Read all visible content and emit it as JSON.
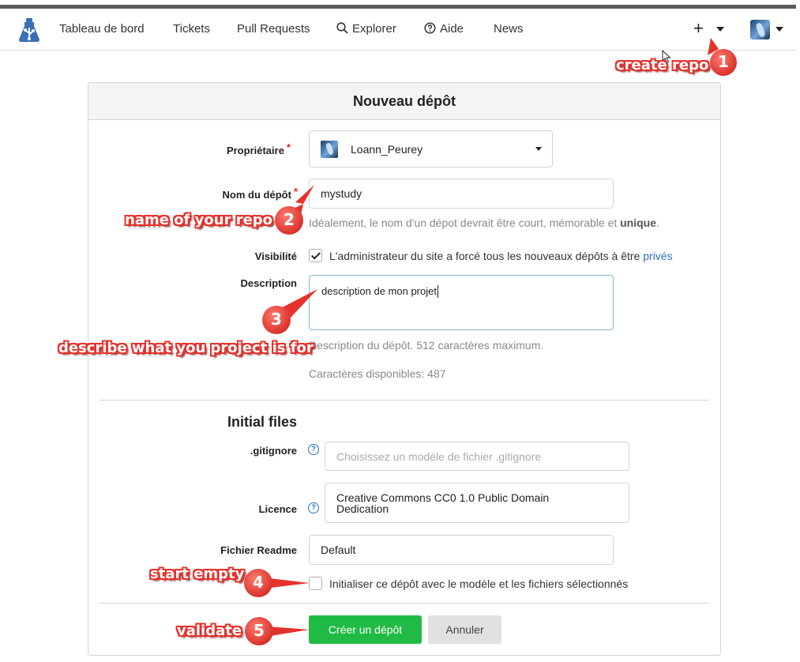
{
  "nav": {
    "items": [
      "Tableau de bord",
      "Tickets",
      "Pull Requests",
      "Explorer",
      "Aide",
      "News"
    ],
    "plus": "+"
  },
  "form": {
    "title": "Nouveau dépôt",
    "owner": {
      "label": "Propriétaire",
      "required": "*",
      "value": "Loann_Peurey"
    },
    "repo_name": {
      "label": "Nom du dépôt",
      "required": "*",
      "value": "mystudy",
      "hint_prefix": "Idéalement, le nom d'un dépot devrait être court, mémorable et ",
      "hint_bold": "unique",
      "hint_suffix": "."
    },
    "visibility": {
      "label": "Visibilité",
      "text": "L'administrateur du site a forcé tous les nouveaux dépôts à être ",
      "link": "privés",
      "checked": true
    },
    "description": {
      "label": "Description",
      "value": "description de mon projet",
      "hint": "Description du dépôt. 512 caractères maximum.",
      "available": "Caractères disponibles: 487"
    },
    "initial_files": {
      "title": "Initial files",
      "gitignore": {
        "label": ".gitignore",
        "placeholder": "Choisissez un modèle de fichier .gitignore"
      },
      "license": {
        "label": "Licence",
        "value": "Creative Commons CC0 1.0 Public Domain Dedication"
      },
      "readme": {
        "label": "Fichier Readme",
        "value": "Default"
      },
      "init": {
        "text": "Initialiser ce dépôt avec le modèle et les fichiers sélectionnés",
        "checked": false
      }
    },
    "buttons": {
      "create": "Créer un dépôt",
      "cancel": "Annuler"
    }
  },
  "annotations": [
    {
      "number": "1",
      "text": "create repo"
    },
    {
      "number": "2",
      "text": "name of your repo"
    },
    {
      "number": "3",
      "text": "describe what you project is for"
    },
    {
      "number": "4",
      "text": "start empty"
    },
    {
      "number": "5",
      "text": "validate"
    }
  ],
  "colors": {
    "accent": "#21ba45",
    "annotation": "#e5322d",
    "link": "#2a6fc3"
  }
}
